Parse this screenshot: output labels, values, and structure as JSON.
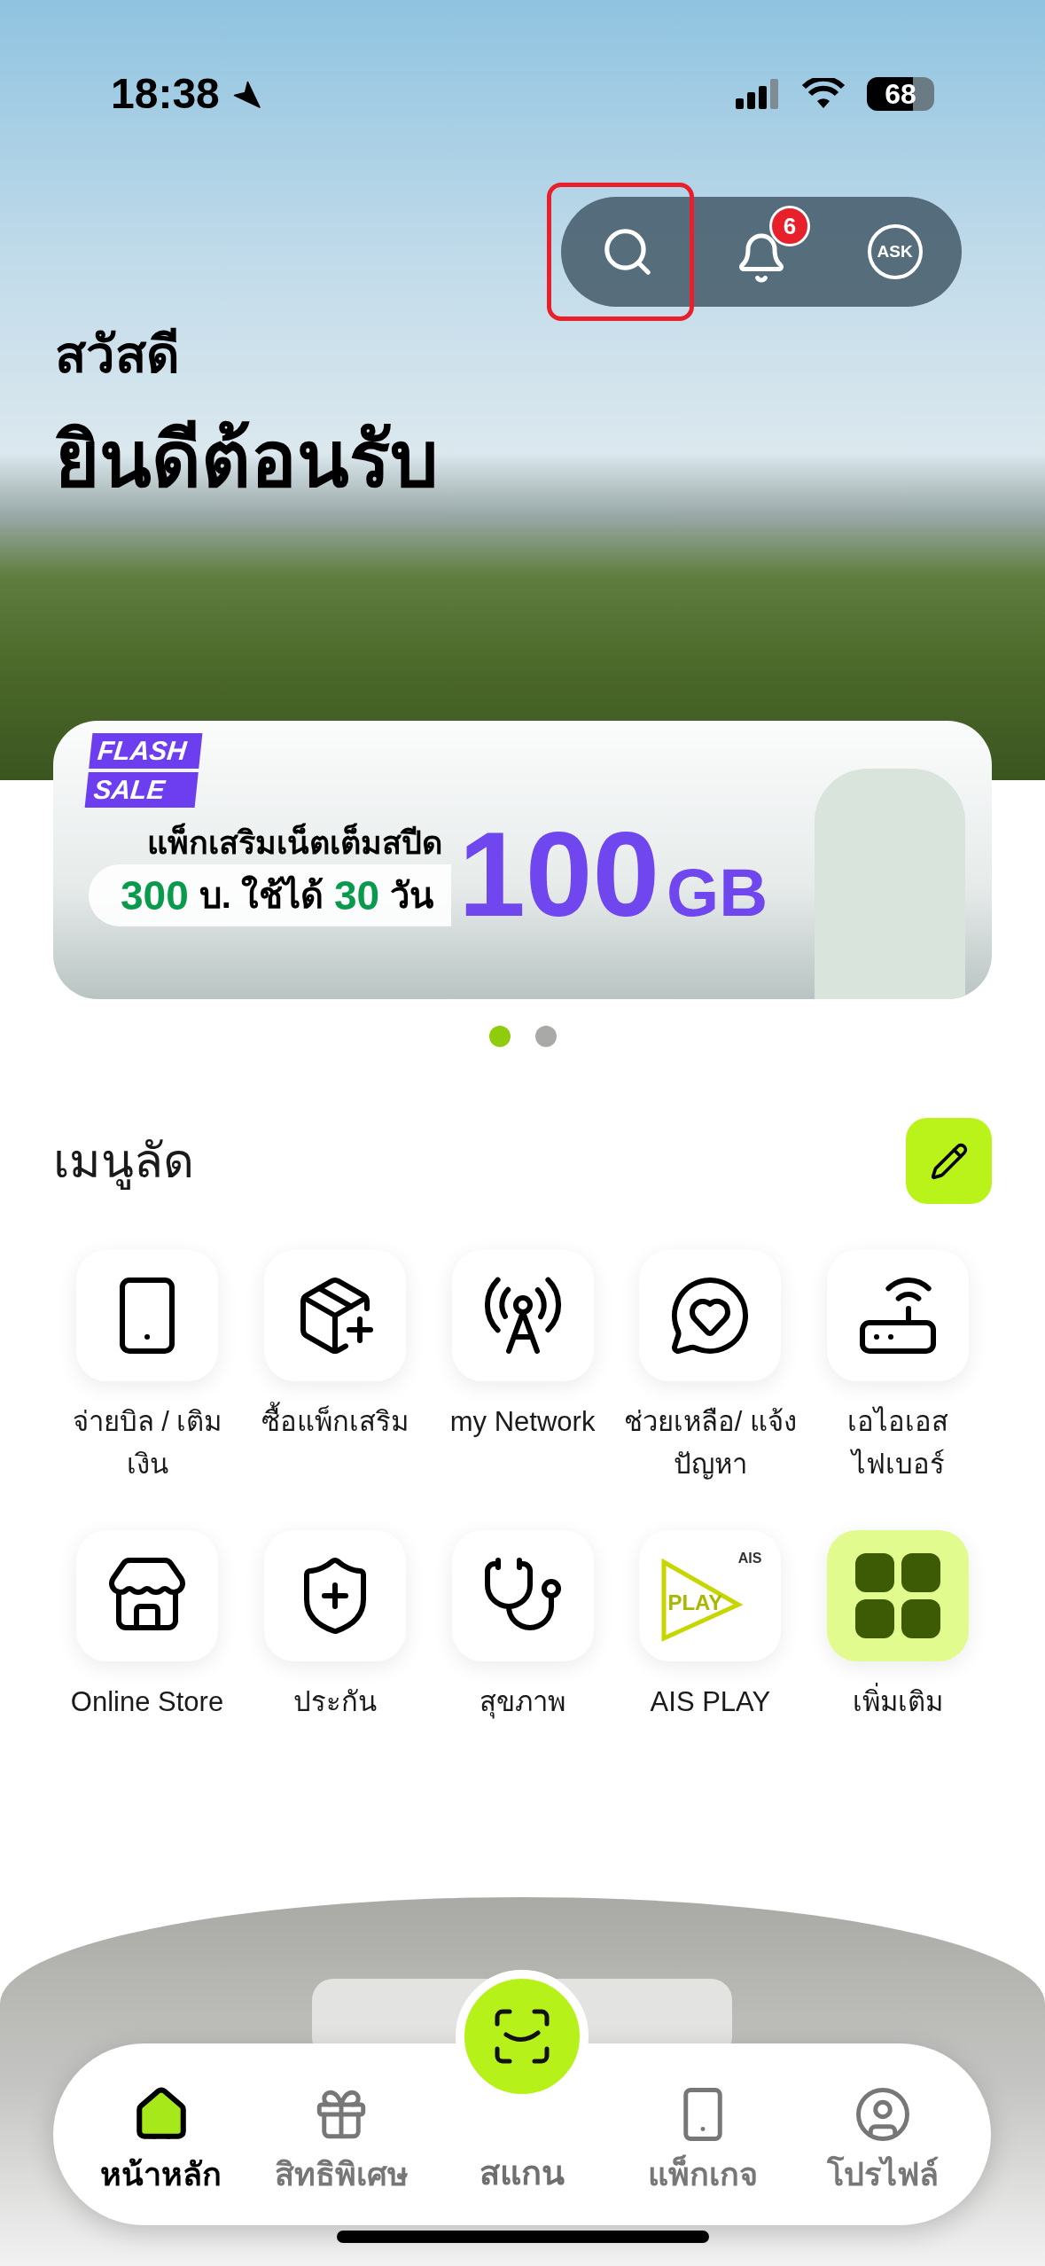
{
  "status_bar": {
    "time": "18:38",
    "battery": "68"
  },
  "header_actions": [
    {
      "kind": "search",
      "highlighted": true
    },
    {
      "kind": "notifications",
      "badge": "6",
      "highlighted": false
    },
    {
      "kind": "ask",
      "label": "ASK",
      "highlighted": false
    }
  ],
  "greeting": {
    "small": "สวัสดี",
    "large": "ยินดีต้อนรับ"
  },
  "banner": {
    "tag_top": "FLASH",
    "tag_bottom": "SALE",
    "headline": "แพ็กเสริมเน็ตเต็มสปีด",
    "price": "300",
    "price_unit": "บ. ใช้ได้",
    "days": "30",
    "days_unit": "วัน",
    "amount": "100",
    "amount_unit": "GB"
  },
  "banner_dots": [
    {
      "selected": true
    },
    {
      "selected": false
    }
  ],
  "shortcuts": {
    "title": "เมนูลัด",
    "items": [
      {
        "label": "จ่ายบิล / เติมเงิน",
        "kind": "shortcut"
      },
      {
        "label": "ซื้อแพ็กเสริม",
        "kind": "shortcut"
      },
      {
        "label": "my Network",
        "kind": "shortcut"
      },
      {
        "label": "ช่วยเหลือ/ แจ้งปัญหา",
        "kind": "shortcut"
      },
      {
        "label": "เอไอเอส ไฟเบอร์",
        "kind": "shortcut"
      },
      {
        "label": "Online Store",
        "kind": "shortcut"
      },
      {
        "label": "ประกัน",
        "kind": "shortcut"
      },
      {
        "label": "สุขภาพ",
        "kind": "shortcut"
      },
      {
        "label": "AIS PLAY",
        "kind": "shortcut",
        "logo_text": "PLAY",
        "logo_brand": "AIS"
      },
      {
        "label": "เพิ่มเติม",
        "kind": "more"
      }
    ]
  },
  "bottom_nav": [
    {
      "label": "หน้าหลัก",
      "kind": "tab",
      "selected": true
    },
    {
      "label": "สิทธิพิเศษ",
      "kind": "tab",
      "selected": false
    },
    {
      "label": "สแกน",
      "kind": "scan",
      "selected": false
    },
    {
      "label": "แพ็กเกจ",
      "kind": "tab",
      "selected": false
    },
    {
      "label": "โปรไฟล์",
      "kind": "tab",
      "selected": false
    }
  ]
}
